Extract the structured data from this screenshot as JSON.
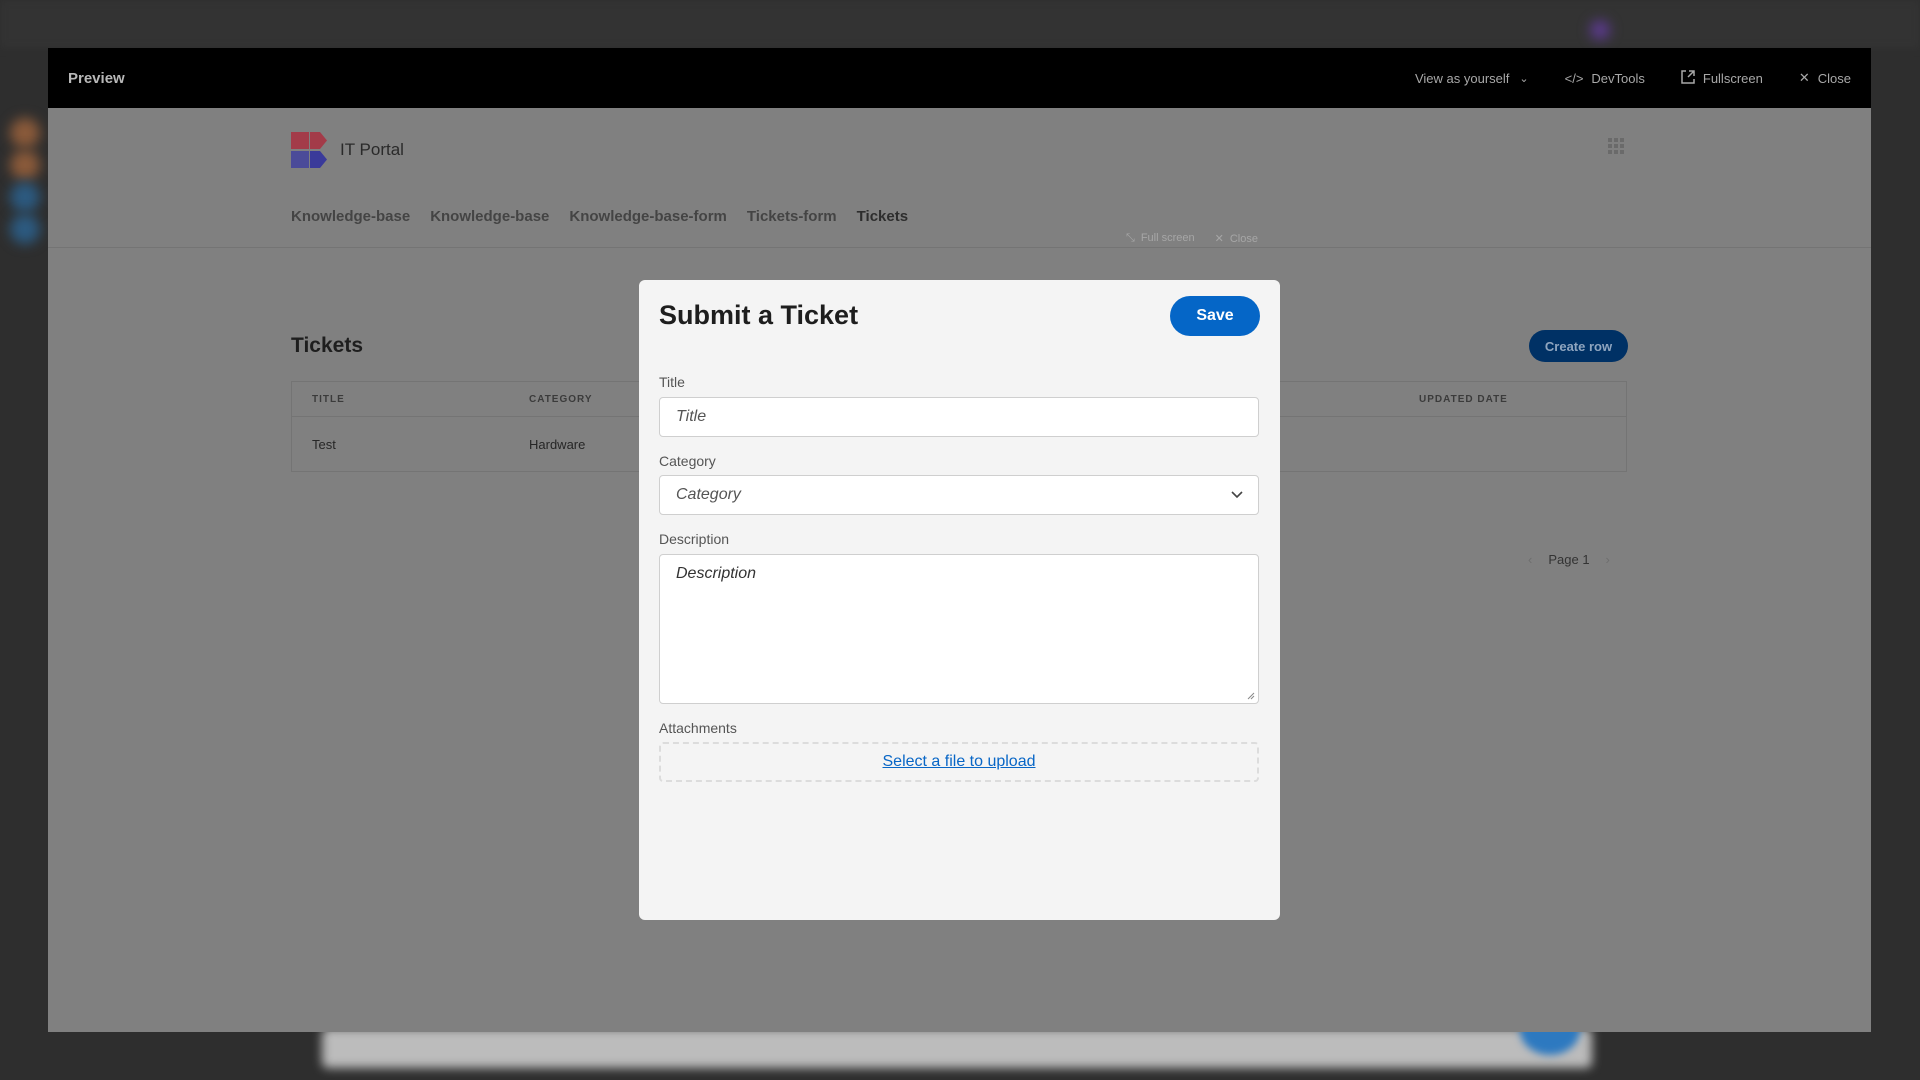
{
  "preview": {
    "title": "Preview",
    "actions": {
      "view_as": "View as yourself",
      "devtools": "DevTools",
      "fullscreen": "Fullscreen",
      "close": "Close"
    }
  },
  "app": {
    "name": "IT Portal",
    "nav": [
      "Knowledge-base",
      "Knowledge-base",
      "Knowledge-base-form",
      "Tickets-form",
      "Tickets"
    ],
    "active_nav": "Tickets",
    "peek": {
      "fullscreen": "Full screen",
      "close": "Close"
    },
    "page_title": "Tickets",
    "create_button": "Create row",
    "table": {
      "columns": [
        "TITLE",
        "CATEGORY",
        "UPDATED DATE"
      ],
      "rows": [
        {
          "title": "Test",
          "category": "Hardware",
          "updated_date": ""
        }
      ]
    },
    "pager": {
      "label": "Page 1"
    }
  },
  "modal": {
    "title": "Submit a Ticket",
    "save_label": "Save",
    "fields": {
      "title": {
        "label": "Title",
        "placeholder": "Title",
        "value": ""
      },
      "category": {
        "label": "Category",
        "placeholder": "Category",
        "value": ""
      },
      "description": {
        "label": "Description",
        "placeholder": "Description",
        "value": ""
      },
      "attachments": {
        "label": "Attachments",
        "link": "Select a file to upload"
      }
    }
  },
  "colors": {
    "primary": "#0566c7",
    "link": "#0866c6",
    "dim_primary": "#003165",
    "logo_red": "#a33b49",
    "logo_blue": "#4b4b99"
  }
}
